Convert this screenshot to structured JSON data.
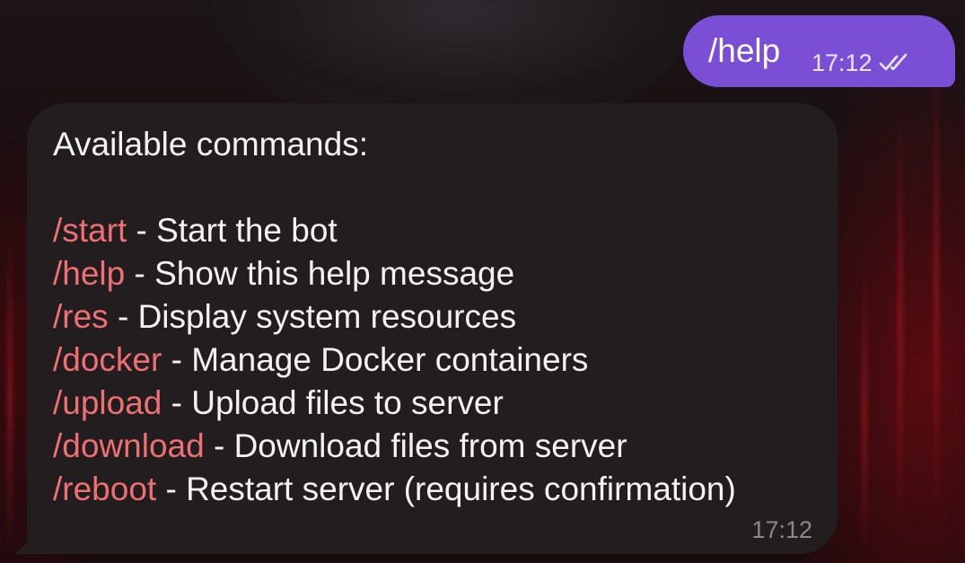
{
  "colors": {
    "outgoing_bubble": "#7a4fd6",
    "incoming_bubble": "#221e1f",
    "command_text": "#ef6f73",
    "message_text": "#f5f2f2",
    "timestamp_muted": "#8c8788"
  },
  "outgoing": {
    "text": "/help",
    "time": "17:12",
    "status_icon": "double-check-icon"
  },
  "incoming": {
    "heading": "Available commands:",
    "commands": [
      {
        "cmd": "/start",
        "desc": " - Start the bot"
      },
      {
        "cmd": "/help",
        "desc": " - Show this help message"
      },
      {
        "cmd": "/res",
        "desc": " - Display system resources"
      },
      {
        "cmd": "/docker",
        "desc": " - Manage Docker containers"
      },
      {
        "cmd": "/upload",
        "desc": " - Upload files to server"
      },
      {
        "cmd": "/download",
        "desc": " - Download files from server"
      },
      {
        "cmd": "/reboot",
        "desc": " - Restart server (requires confirmation)"
      }
    ],
    "time": "17:12"
  }
}
